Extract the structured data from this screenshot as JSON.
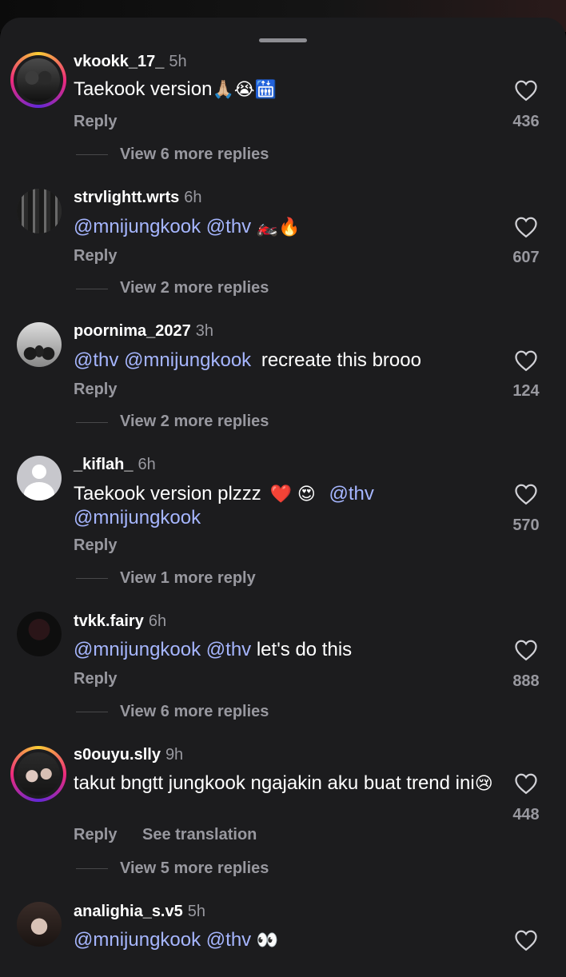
{
  "comments": [
    {
      "username": "vkookk_17_",
      "time": "5h",
      "text_parts": [
        {
          "t": "Taekook version",
          "m": false
        }
      ],
      "emojis": "🙏🏼😭🛗",
      "reply_label": "Reply",
      "view_more": "View 6 more replies",
      "likes": "436",
      "avatar_ring": true
    },
    {
      "username": "strvlightt.wrts",
      "time": "6h",
      "mention1": "@mnijungkook",
      "mention2": "@thv",
      "emojis": "🏍️🔥",
      "reply_label": "Reply",
      "view_more": "View 2 more replies",
      "likes": "607"
    },
    {
      "username": "poornima_2027",
      "time": "3h",
      "mention1": "@thv",
      "mention2": "@mnijungkook",
      "plain": "recreate this brooo",
      "reply_label": "Reply",
      "view_more": "View 2 more replies",
      "likes": "124"
    },
    {
      "username": "_kiflah_",
      "time": "6h",
      "plain": "Taekook version plzzz",
      "emojis": "❤️ 😍",
      "mention1": "@thv",
      "mention2": "@mnijungkook",
      "reply_label": "Reply",
      "view_more": "View 1 more reply",
      "likes": "570"
    },
    {
      "username": "tvkk.fairy",
      "time": "6h",
      "mention1": "@mnijungkook",
      "mention2": "@thv",
      "plain": "let's do this",
      "reply_label": "Reply",
      "view_more": "View 6 more replies",
      "likes": "888"
    },
    {
      "username": "s0ouyu.slly",
      "time": "9h",
      "plain": "takut bngtt jungkook ngajakin aku buat trend ini",
      "emojis": "😢",
      "reply_label": "Reply",
      "see_translation": "See translation",
      "view_more": "View 5 more replies",
      "likes": "448",
      "avatar_ring": true
    },
    {
      "username": "analighia_s.v5",
      "time": "5h",
      "mention1": "@mnijungkook",
      "mention2": "@thv",
      "emojis": "👀"
    }
  ],
  "colors": {
    "sheet": "#1c1c1e",
    "mention": "#a6b6ff",
    "secondary": "#98989f"
  },
  "icons": {
    "like": "heart-outline-icon"
  }
}
